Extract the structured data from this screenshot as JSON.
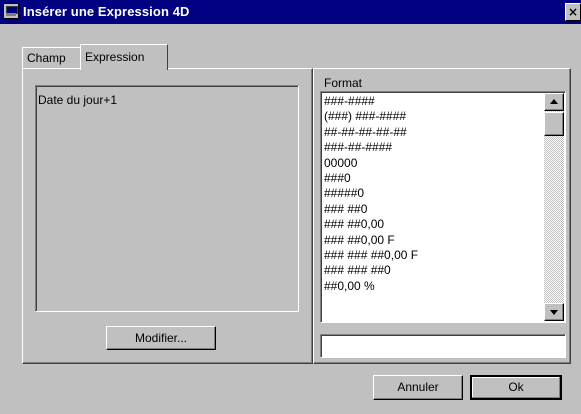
{
  "window": {
    "title": "Insérer une Expression 4D",
    "close_label": "×"
  },
  "tabs": [
    {
      "label": "Champ",
      "active": false
    },
    {
      "label": "Expression",
      "active": true
    }
  ],
  "expression": {
    "value": "Date du jour+1",
    "modify_label": "Modifier..."
  },
  "format": {
    "label": "Format",
    "items": [
      "###-####",
      "(###) ###-####",
      "##-##-##-##-##",
      "###-##-####",
      "00000",
      "###0",
      "#####0",
      "### ##0",
      "### ##0,00",
      "### ##0,00 F",
      "### ### ##0,00 F",
      "### ### ##0",
      "##0,00 %"
    ],
    "input_value": "",
    "scroll_position": 0.0
  },
  "buttons": {
    "cancel_label": "Annuler",
    "ok_label": "Ok"
  }
}
